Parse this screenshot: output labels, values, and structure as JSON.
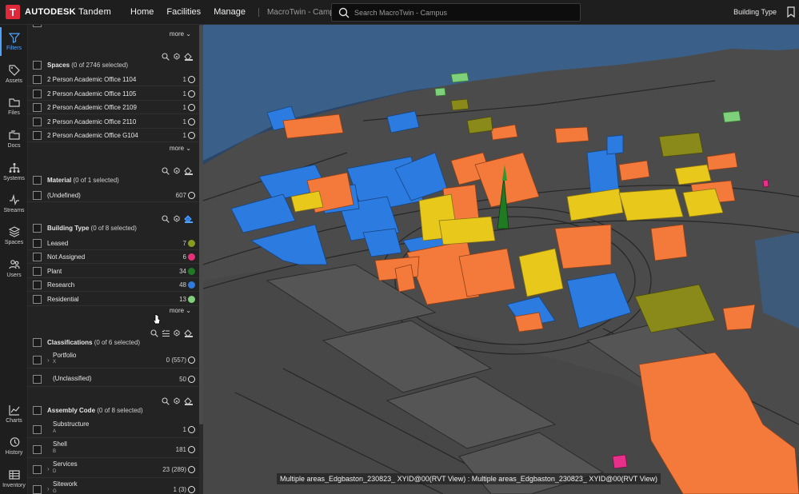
{
  "topbar": {
    "logo_mark": "T",
    "logo_brand": "AUTODESK",
    "logo_product": "Tandem",
    "nav": [
      "Home",
      "Facilities",
      "Manage"
    ],
    "breadcrumb": "MacroTwin - Campus",
    "search_placeholder": "Search MacroTwin - Campus",
    "right_label": "Building Type"
  },
  "rail": {
    "items": [
      {
        "label": "Filters",
        "icon": "funnel-icon",
        "active": true
      },
      {
        "label": "Assets",
        "icon": "tag-icon"
      },
      {
        "label": "Files",
        "icon": "folder-icon"
      },
      {
        "label": "Docs",
        "icon": "docs-icon"
      },
      {
        "label": "Systems",
        "icon": "hierarchy-icon"
      },
      {
        "label": "Streams",
        "icon": "pulse-icon"
      },
      {
        "label": "Spaces",
        "icon": "layers-icon"
      },
      {
        "label": "Users",
        "icon": "users-icon"
      },
      {
        "label": "Charts",
        "icon": "chart-icon"
      },
      {
        "label": "History",
        "icon": "history-icon"
      },
      {
        "label": "Inventory",
        "icon": "table-icon"
      }
    ]
  },
  "panel": {
    "more_label": "more",
    "spaces": {
      "title": "Spaces",
      "summary": "(0 of 2746 selected)",
      "items": [
        {
          "label": "2 Person Academic Office 1104",
          "count": "1"
        },
        {
          "label": "2 Person Academic Office 1105",
          "count": "1"
        },
        {
          "label": "2 Person Academic Office 2109",
          "count": "1"
        },
        {
          "label": "2 Person Academic Office 2110",
          "count": "1"
        },
        {
          "label": "2 Person Academic Office G104",
          "count": "1"
        }
      ]
    },
    "material": {
      "title": "Material",
      "summary": "(0 of 1 selected)",
      "items": [
        {
          "label": "(Undefined)",
          "count": "607"
        }
      ]
    },
    "building_type": {
      "title": "Building Type",
      "summary": "(0 of 8 selected)",
      "items": [
        {
          "label": "Leased",
          "count": "7",
          "color": "#8a9a1e"
        },
        {
          "label": "Not Assigned",
          "count": "6",
          "color": "#e8307a"
        },
        {
          "label": "Plant",
          "count": "34",
          "color": "#1f7a22"
        },
        {
          "label": "Research",
          "count": "48",
          "color": "#2e7be0"
        },
        {
          "label": "Residential",
          "count": "13",
          "color": "#7fd07a"
        }
      ]
    },
    "classifications": {
      "title": "Classifications",
      "summary": "(0 of 6 selected)",
      "items": [
        {
          "label": "Portfolio",
          "sub": "X",
          "count": "0 (557)",
          "expandable": true
        },
        {
          "label": "(Unclassified)",
          "sub": "",
          "count": "50",
          "expandable": false
        }
      ]
    },
    "assembly_code": {
      "title": "Assembly Code",
      "summary": "(0 of 8 selected)",
      "items": [
        {
          "label": "Substructure",
          "sub": "A",
          "count": "1"
        },
        {
          "label": "Shell",
          "sub": "B",
          "count": "181"
        },
        {
          "label": "Services",
          "sub": "D",
          "count": "23 (289)"
        },
        {
          "label": "Sitework",
          "sub": "G",
          "count": "1 (3)"
        }
      ]
    }
  },
  "viewer": {
    "status_text": "Multiple areas_Edgbaston_230823_ XYID@00(RVT View) : Multiple areas_Edgbaston_230823_ XYID@00(RVT View)",
    "colors": {
      "orange": "#f47a3c",
      "blue": "#2c7be0",
      "yellow": "#e8c81a",
      "olive": "#8a8a1a",
      "green": "#1f7a22",
      "magenta": "#e8308a",
      "water": "#2d4a6e",
      "ground": "#4a4a4a"
    }
  }
}
